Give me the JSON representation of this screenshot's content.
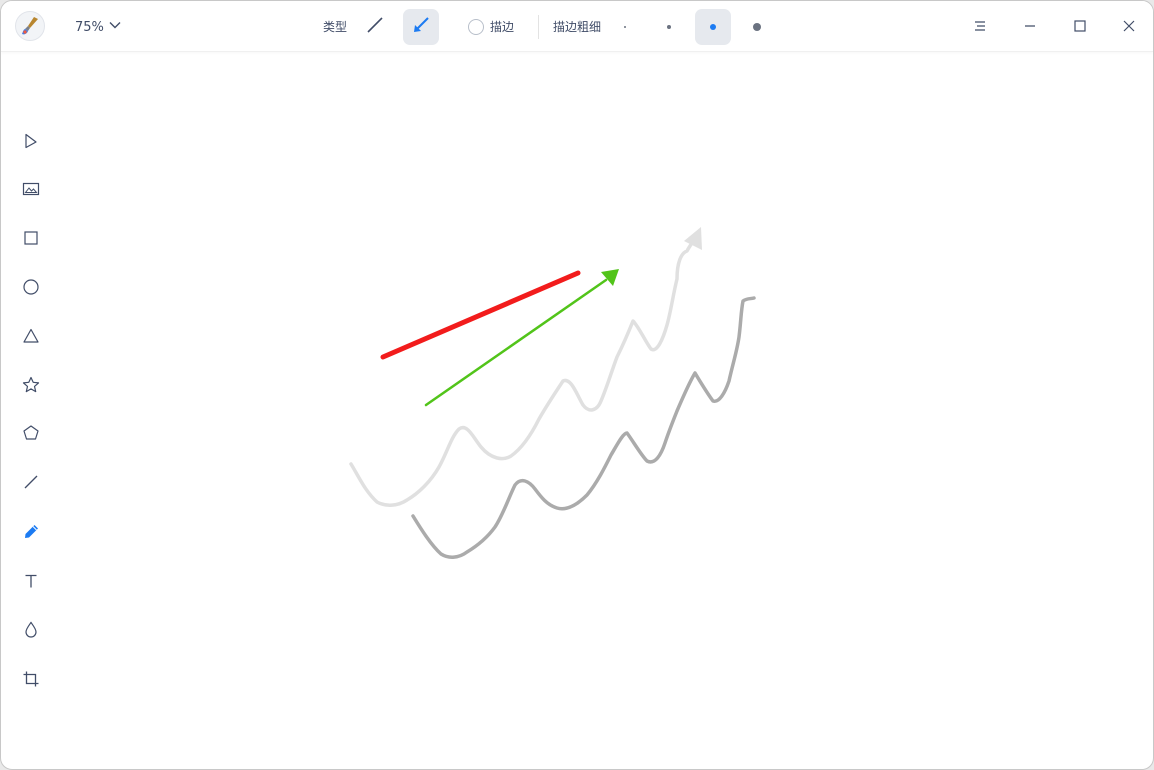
{
  "toolbar": {
    "zoom": "75%",
    "type_label": "类型",
    "stroke_label": "描边",
    "stroke_width_label": "描边粗细"
  },
  "icons": {
    "app": "paint-brush-icon",
    "line_type": "line-icon",
    "arrow_type": "arrow-icon",
    "menu": "hamburger-icon",
    "minimize": "minimize-icon",
    "maximize": "maximize-icon",
    "close": "close-icon"
  },
  "sidebar": {
    "items": [
      {
        "name": "select",
        "icon": "pointer-icon"
      },
      {
        "name": "image",
        "icon": "image-icon"
      },
      {
        "name": "rectangle",
        "icon": "rectangle-icon"
      },
      {
        "name": "ellipse",
        "icon": "ellipse-icon"
      },
      {
        "name": "triangle",
        "icon": "triangle-icon"
      },
      {
        "name": "star",
        "icon": "star-icon"
      },
      {
        "name": "polygon",
        "icon": "pentagon-icon"
      },
      {
        "name": "line",
        "icon": "line-icon"
      },
      {
        "name": "pen",
        "icon": "pen-icon",
        "active": true
      },
      {
        "name": "text",
        "icon": "text-icon"
      },
      {
        "name": "blur",
        "icon": "drop-icon"
      },
      {
        "name": "crop",
        "icon": "crop-icon"
      }
    ]
  },
  "colors": {
    "accent": "#1c7bf2",
    "red_line": "#f21c1c",
    "green_arrow": "#52c41a",
    "light_gray_stroke": "#e0e0e0",
    "dark_gray_stroke": "#ababab"
  },
  "state": {
    "selected_type": "arrow",
    "stroke_checked": false,
    "selected_stroke_width_index": 2
  }
}
